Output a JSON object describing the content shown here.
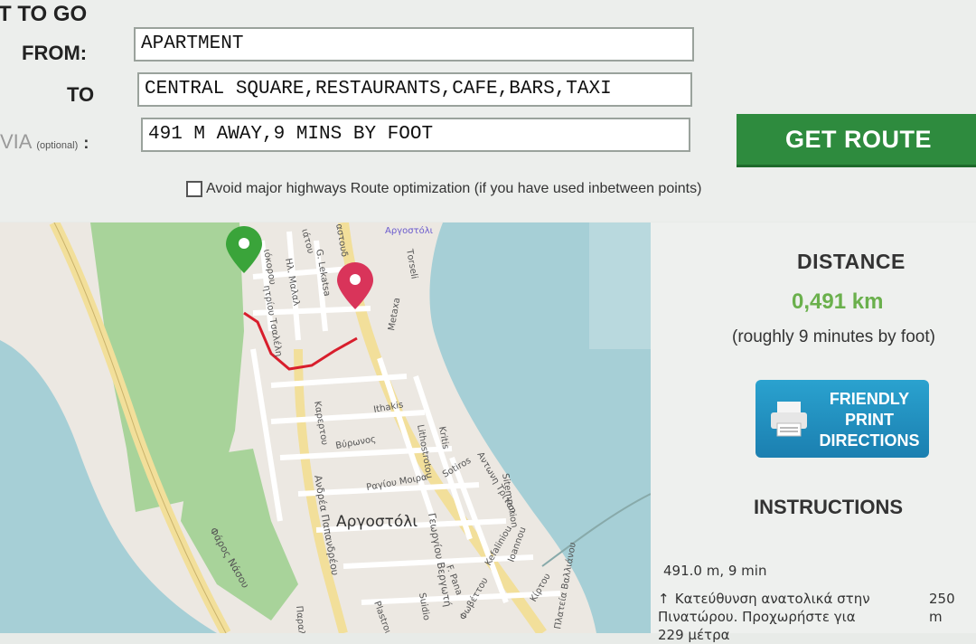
{
  "form": {
    "heading": "T TO GO",
    "from_label": "FROM:",
    "from_value": "APARTMENT",
    "to_label": "TO",
    "to_value": "CENTRAL SQUARE,RESTAURANTS,CAFE,BARS,TAXI",
    "via_label": "VIA",
    "via_optional": "(optional)",
    "via_colon": ":",
    "via_value": "491 M AWAY,9 MINS BY FOOT",
    "get_route_label": "GET ROUTE",
    "avoid_label": "Avoid major highways Route optimization (if you have used inbetween points)"
  },
  "map": {
    "streets": {
      "s1": "ιόκορου",
      "s2": "ιάτου",
      "s3": "Ηλ. Μαλαλ",
      "s4": "G. Lekatsa",
      "s5": "αστουδ",
      "s6": "Αργοστόλι",
      "s7": "Τorseli",
      "s8": "ητρίου Τσαλέλη",
      "s9": "Metaxa",
      "s10": "Ithakis",
      "s11": "Kritis",
      "s12": "Lithostrotou",
      "s13": "Βύρωνος",
      "s14": "Καρερτου",
      "s15": "Sotiros",
      "s16": "Αντωνη Τρίταη",
      "s17": "Sitemporion",
      "s18": "Ραγίου Μοιρα",
      "s19": "Ανδρέα Παπανδρέου",
      "s20": "Γεωργίου Βεργωτή",
      "s21": "Kefaliniou",
      "s22": "Ioannou",
      "s23": "Φάρος Νάσου",
      "s24": "F. Pana",
      "s25": "Suidio",
      "s26": "Φωβέττου",
      "s27": "Κίρτου",
      "s28": "Πλατεία Βαλλιάνου",
      "s29": "Plastrou",
      "s30": "Παραλ"
    },
    "city_label": "Αργοστόλι"
  },
  "side": {
    "distance_title": "DISTANCE",
    "distance_value": "0,491 km",
    "distance_note": "(roughly 9 minutes by foot)",
    "print_label_line1": "FRIENDLY",
    "print_label_line2": "PRINT",
    "print_label_line3": "DIRECTIONS",
    "instructions_title": "INSTRUCTIONS",
    "summary": "491.0 m, 9 min",
    "step1_line1": "Κατεύθυνση ανατολικά στην",
    "step1_line2": "Πινατώρου. Προχωρήστε για",
    "step1_line3": "229 μέτρα",
    "step1_distance": "250 m"
  },
  "colors": {
    "route_button": "#2e8b3e",
    "distance_value": "#6ab04c",
    "print_button": "#1b7fb0",
    "start_marker": "#3aa43a",
    "end_marker": "#d9345a",
    "route_line": "#d81e2c",
    "sea": "#a6cfd6",
    "park": "#a8d39a"
  },
  "icons": {
    "start": "map-pin-green-icon",
    "end": "map-pin-red-icon",
    "printer": "printer-icon",
    "step": "arrow-up-icon"
  }
}
